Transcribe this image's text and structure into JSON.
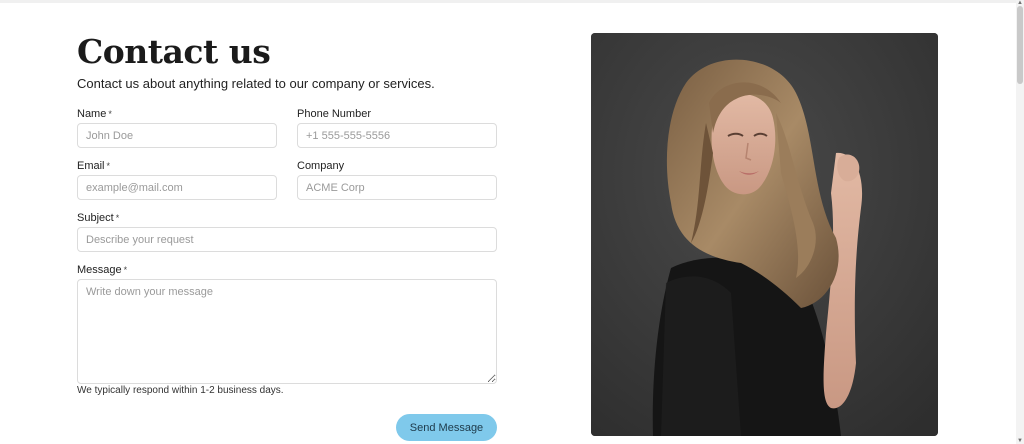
{
  "header": {
    "title": "Contact us",
    "subtitle": "Contact us about anything related to our company or services."
  },
  "form": {
    "name": {
      "label": "Name",
      "required_mark": "*",
      "placeholder": "John Doe"
    },
    "phone": {
      "label": "Phone Number",
      "placeholder": "+1 555-555-5556"
    },
    "email": {
      "label": "Email",
      "required_mark": "*",
      "placeholder": "example@mail.com"
    },
    "company": {
      "label": "Company",
      "placeholder": "ACME Corp"
    },
    "subject": {
      "label": "Subject",
      "required_mark": "*",
      "placeholder": "Describe your request"
    },
    "message": {
      "label": "Message",
      "required_mark": "*",
      "placeholder": "Write down your message"
    },
    "hint": "We typically respond within 1-2 business days.",
    "submit_label": "Send Message"
  },
  "colors": {
    "accent": "#7fc9eb",
    "photo_background": "#3f3f3f"
  },
  "icons": {
    "scroll_up": "▲",
    "scroll_down": "▼"
  }
}
